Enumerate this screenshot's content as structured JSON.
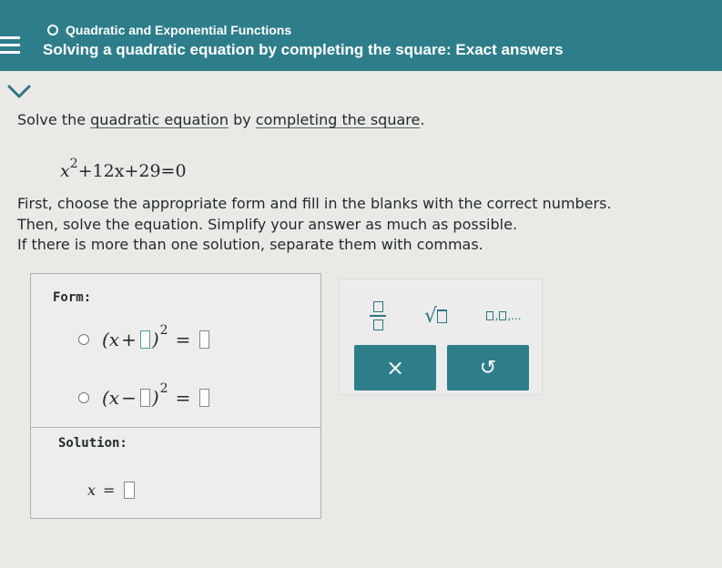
{
  "header": {
    "topic": "Quadratic and Exponential Functions",
    "lesson_title": "Solving a quadratic equation by completing the square: Exact answers"
  },
  "problem": {
    "intro_prefix": "Solve the ",
    "link_quadratic_equation": "quadratic equation",
    "intro_middle": " by ",
    "link_completing_square": "completing the square",
    "intro_suffix": ".",
    "equation": {
      "var": "x",
      "exponent": "2",
      "rest": "+12x+29=0"
    },
    "instruction_1": "First, choose the appropriate form and fill in the blanks with the correct numbers.",
    "instruction_2": "Then, solve the equation. Simplify your answer as much as possible.",
    "instruction_3": "If there is more than one solution, separate them with commas."
  },
  "answer_panel": {
    "form_label": "Form:",
    "options": [
      {
        "open": "(x",
        "op": "+",
        "close": ")",
        "exponent": "2",
        "equals": "="
      },
      {
        "open": "(x",
        "op": "−",
        "close": ")",
        "exponent": "2",
        "equals": "="
      }
    ],
    "solution_label": "Solution:",
    "solution_var": "x",
    "solution_equals": "="
  },
  "tools": {
    "sqrt_symbol": "√",
    "list_ellipsis": "...",
    "clear_symbol": "×",
    "undo_symbol": "↺"
  },
  "colors": {
    "header_bg": "#2d7e8a",
    "accent": "#2b7582",
    "background": "#ebe9e6"
  }
}
